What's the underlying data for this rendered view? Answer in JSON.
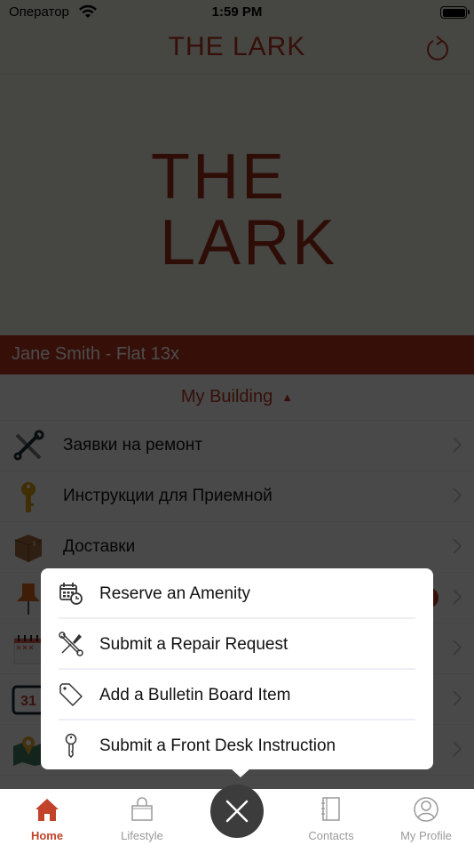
{
  "status_bar": {
    "carrier": "Оператор",
    "time": "1:59 PM"
  },
  "nav": {
    "title": "THE LARK",
    "refresh_icon": "refresh-icon"
  },
  "hero": {
    "logo_line1": "THE",
    "logo_line2": "LARK"
  },
  "resident": {
    "label": "Jane Smith - Flat 13x"
  },
  "building_section": {
    "header": "My Building",
    "caret": "▲",
    "items": [
      {
        "label": "Заявки на ремонт",
        "icon": "tools-icon"
      },
      {
        "label": "Инструкции для Приемной",
        "icon": "key-icon"
      },
      {
        "label": "Доставки",
        "icon": "package-icon"
      },
      {
        "label": "",
        "icon": "pushpin-icon",
        "badge": true
      },
      {
        "label": "",
        "icon": "calendar-grid-icon"
      },
      {
        "label": "",
        "icon": "calendar-31-icon",
        "icon_text": "31"
      },
      {
        "label": "",
        "icon": "map-pin-icon"
      }
    ]
  },
  "popup_menu": {
    "items": [
      {
        "label": "Reserve an Amenity",
        "icon": "calendar-clock-icon"
      },
      {
        "label": "Submit a Repair Request",
        "icon": "wrench-screwdriver-icon"
      },
      {
        "label": "Add a Bulletin Board Item",
        "icon": "tag-icon"
      },
      {
        "label": "Submit a Front Desk Instruction",
        "icon": "key-icon"
      }
    ]
  },
  "tab_bar": {
    "tabs": [
      {
        "label": "Home",
        "icon": "home-icon",
        "active": true
      },
      {
        "label": "Lifestyle",
        "icon": "shopping-bag-icon",
        "active": false
      },
      {
        "label": "Contacts",
        "icon": "notebook-icon",
        "active": false
      },
      {
        "label": "My Profile",
        "icon": "user-circle-icon",
        "active": false
      }
    ],
    "close_icon": "close-icon"
  },
  "colors": {
    "brand": "#b5341e",
    "background": "#ecebe1",
    "fab": "#3c3c3c"
  }
}
